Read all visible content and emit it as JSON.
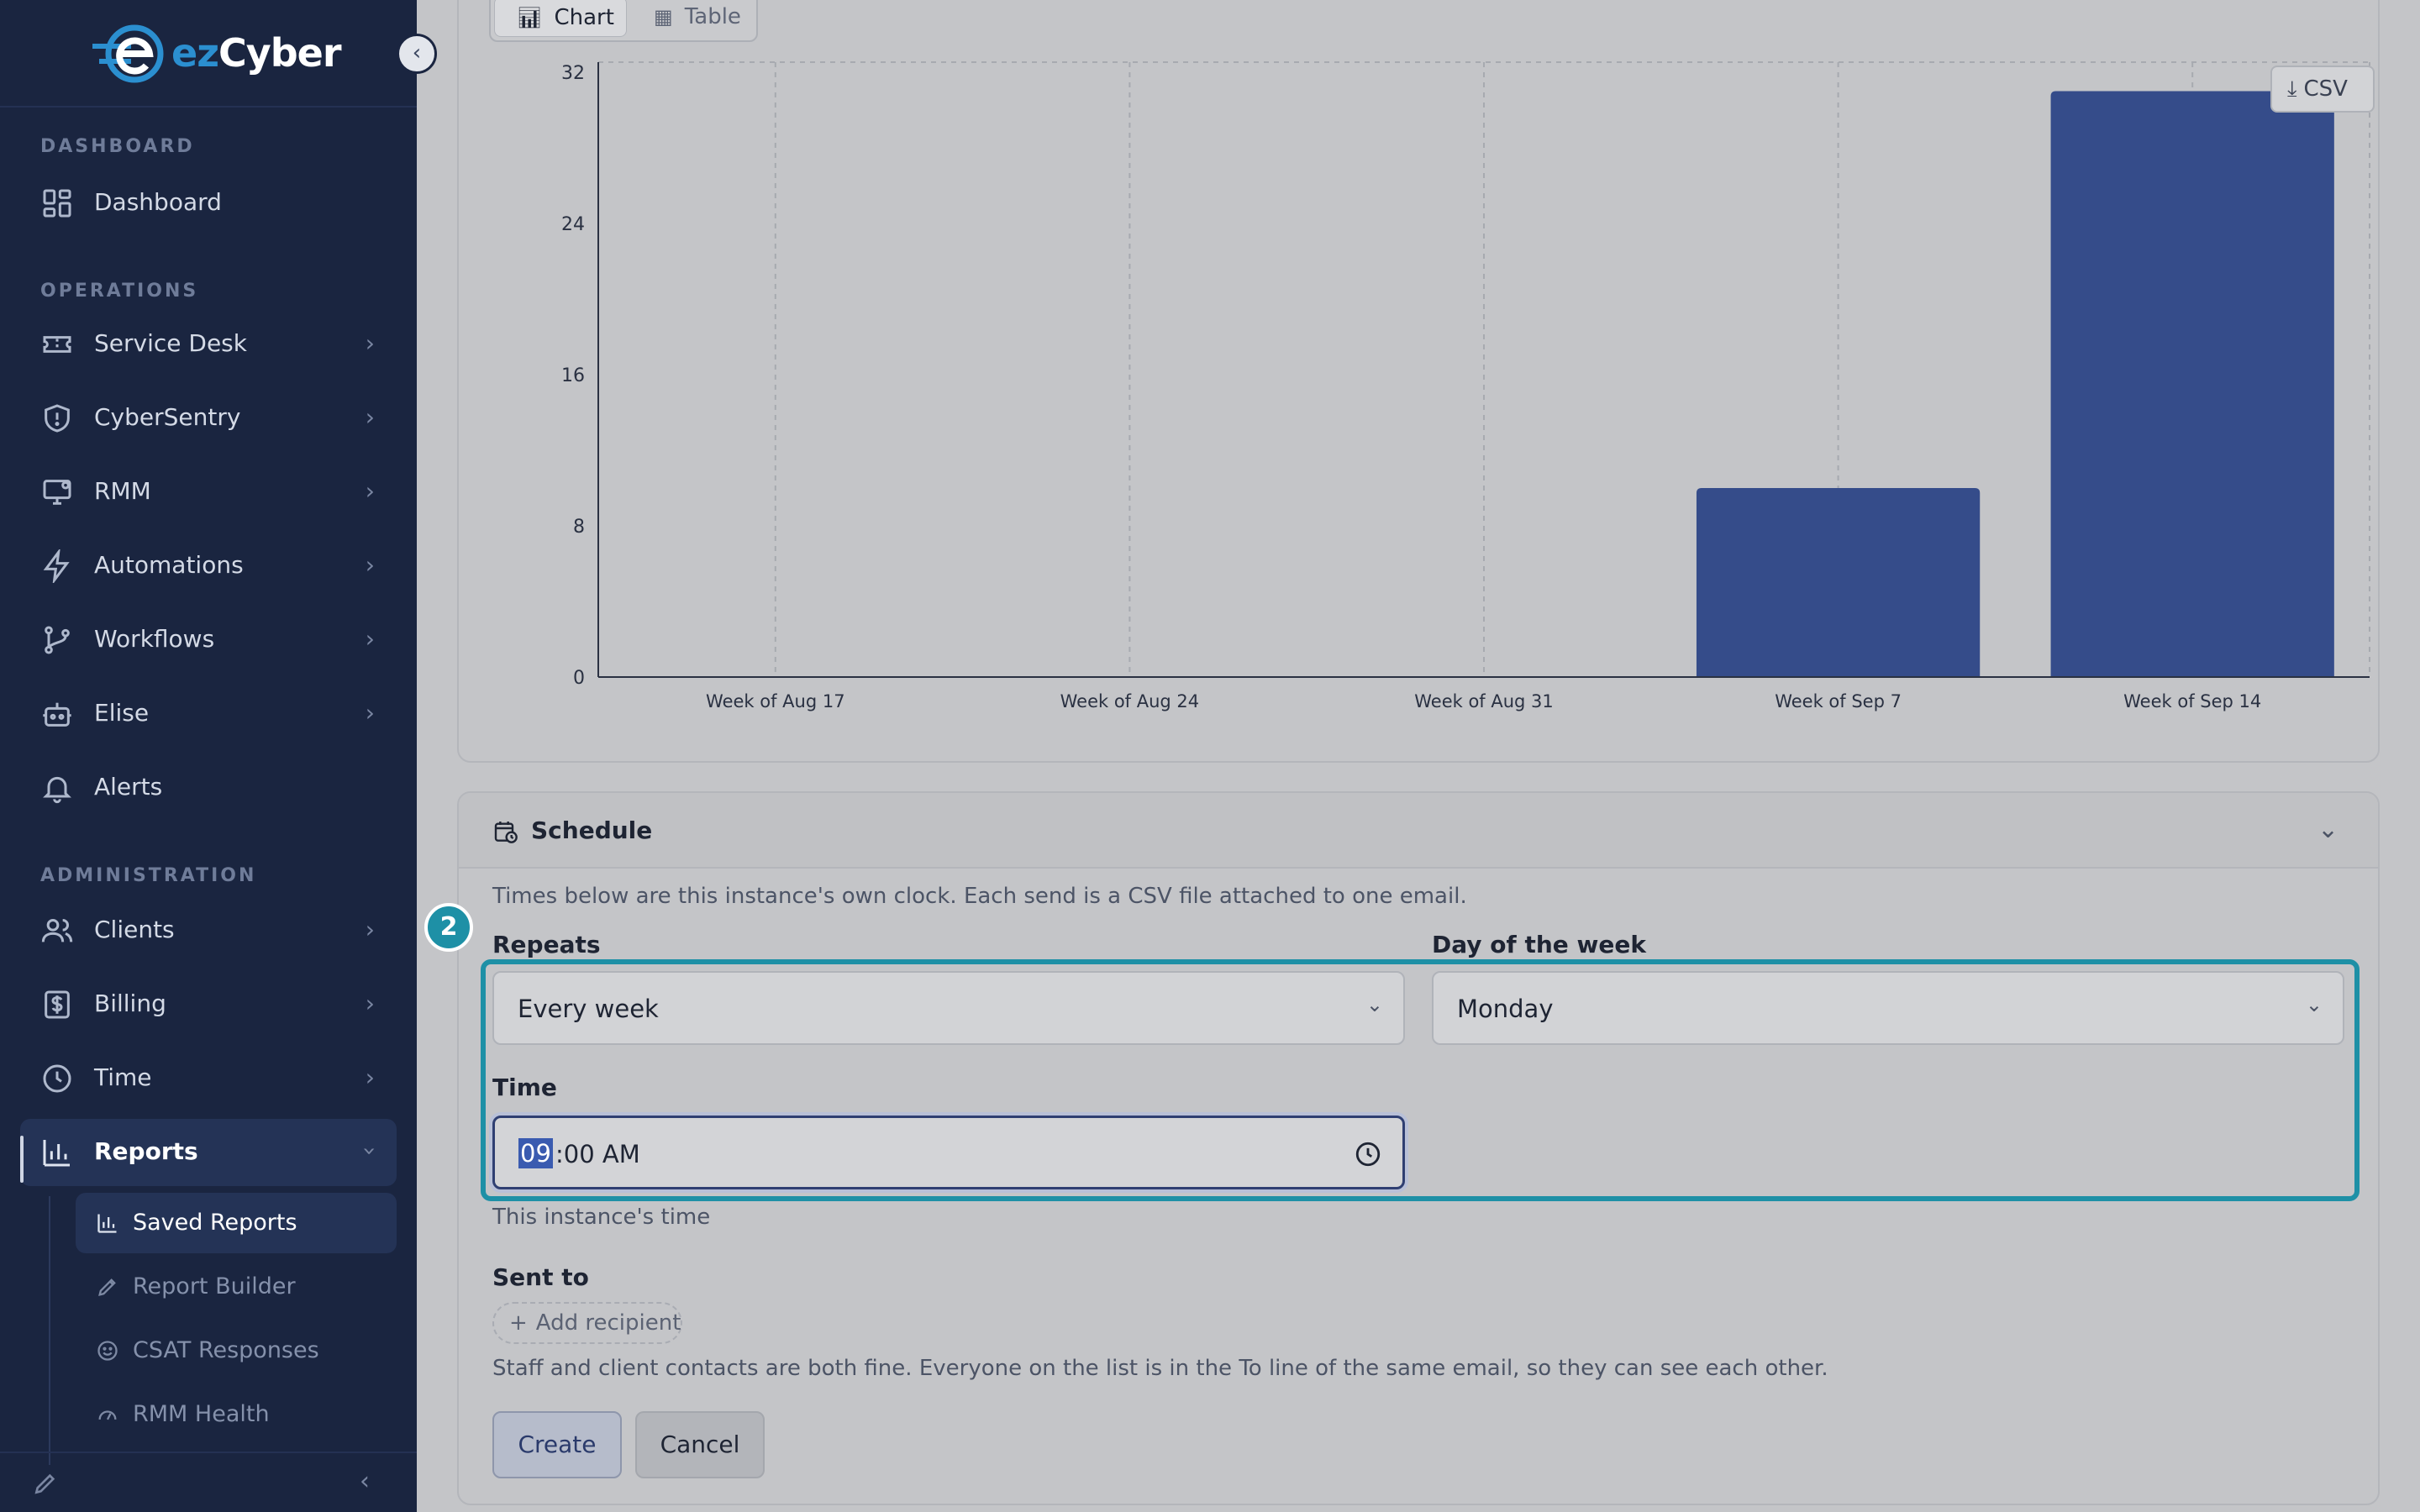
{
  "brand": {
    "prefix": "ez",
    "name": "Cyber"
  },
  "sidebar": {
    "sections": [
      {
        "label": "DASHBOARD",
        "items": [
          {
            "label": "Dashboard",
            "icon": "dashboard-icon"
          }
        ]
      },
      {
        "label": "OPERATIONS",
        "items": [
          {
            "label": "Service Desk",
            "icon": "ticket-icon"
          },
          {
            "label": "CyberSentry",
            "icon": "shield-icon"
          },
          {
            "label": "RMM",
            "icon": "monitor-icon"
          },
          {
            "label": "Automations",
            "icon": "lightning-icon"
          },
          {
            "label": "Workflows",
            "icon": "git-branch-icon"
          },
          {
            "label": "Elise",
            "icon": "robot-icon"
          },
          {
            "label": "Alerts",
            "icon": "bell-icon"
          }
        ]
      },
      {
        "label": "ADMINISTRATION",
        "items": [
          {
            "label": "Clients",
            "icon": "users-icon"
          },
          {
            "label": "Billing",
            "icon": "dollar-icon"
          },
          {
            "label": "Time",
            "icon": "clock-icon"
          },
          {
            "label": "Reports",
            "icon": "bar-chart-icon"
          }
        ]
      }
    ],
    "reports_sub": [
      {
        "label": "Saved Reports",
        "icon": "bar-chart-icon"
      },
      {
        "label": "Report Builder",
        "icon": "pencil-ruler-icon"
      },
      {
        "label": "CSAT Responses",
        "icon": "smile-icon"
      },
      {
        "label": "RMM Health",
        "icon": "gauge-icon"
      }
    ]
  },
  "view_toggle": {
    "chart": "Chart",
    "table": "Table"
  },
  "csv_button": "CSV",
  "chart_data": {
    "type": "bar",
    "categories": [
      "Week of Aug 17",
      "Week of Aug 24",
      "Week of Aug 31",
      "Week of Sep 7",
      "Week of Sep 14"
    ],
    "values": [
      0,
      0,
      0,
      10,
      31
    ],
    "ylim": [
      0,
      32
    ],
    "yticks": [
      0,
      8,
      16,
      24,
      32
    ],
    "grid": "vertical dashed",
    "bar_color": "#354c8a"
  },
  "schedule": {
    "title": "Schedule",
    "description": "Times below are this instance's own clock. Each send is a CSV file attached to one email.",
    "badge": "2",
    "repeats": {
      "label": "Repeats",
      "value": "Every week"
    },
    "day_of_week": {
      "label": "Day of the week",
      "value": "Monday"
    },
    "time": {
      "label": "Time",
      "hour": "09",
      "rest": ":00 AM",
      "hint": "This instance's time"
    },
    "sent_to": {
      "label": "Sent to",
      "add_label": "Add recipient",
      "note": "Staff and client contacts are both fine. Everyone on the list is in the To line of the same email, so they can see each other."
    },
    "create_label": "Create",
    "cancel_label": "Cancel"
  },
  "colors": {
    "sidebar_bg": "#1a2540",
    "accent_teal": "#1e90a6",
    "bar": "#354c8a"
  }
}
